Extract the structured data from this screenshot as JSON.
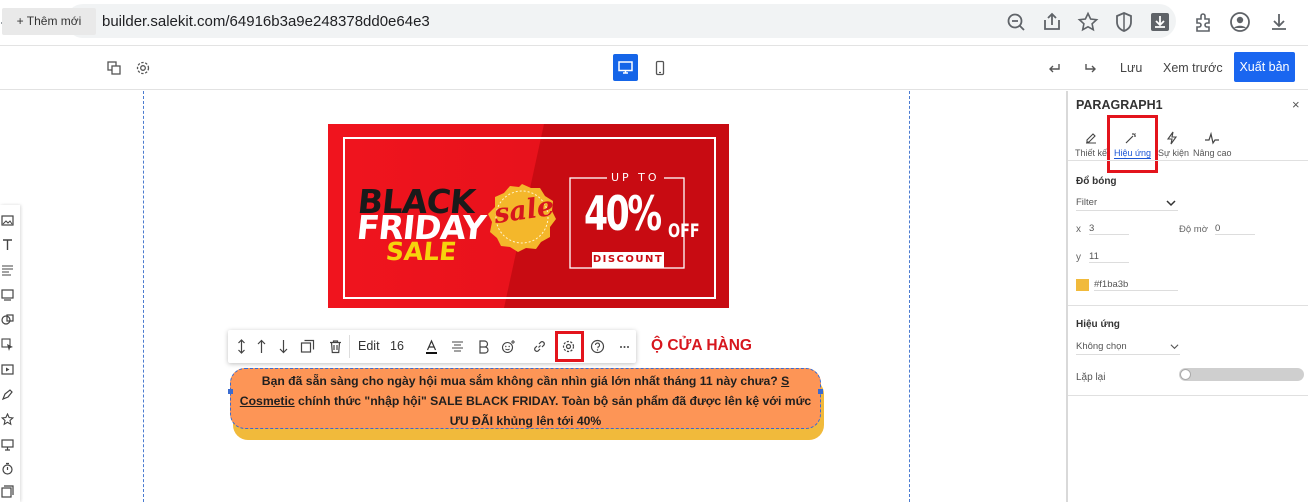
{
  "browser": {
    "url": "builder.salekit.com/64916b3a9e248378dd0e64e3"
  },
  "builder_toolbar": {
    "add_new": "+ Thêm mới",
    "save": "Lưu",
    "preview": "Xem trước",
    "publish": "Xuất bản"
  },
  "element_toolbar": {
    "edit": "Edit",
    "font_size": "16"
  },
  "banner": {
    "black": "BLACK",
    "friday": "FRIDAY",
    "sale": "SALE",
    "sale_badge": "sale",
    "up_to": "UP TO",
    "percent": "40%",
    "off": "OFF",
    "discount": "DISCOUNT"
  },
  "heading_fragment": "Ộ CỬA HÀNG",
  "paragraph": {
    "text_before": "Bạn đã sẵn sàng cho ngày hội mua sắm không cần nhìn giá lớn nhất tháng 11 này chưa? ",
    "link": "S Cosmetic",
    "text_after": " chính thức \"nhập hội\" SALE BLACK FRIDAY. Toàn bộ sản phẩm đã được lên kệ với mức ƯU ĐÃI khủng lên tới 40%"
  },
  "panel": {
    "title": "PARAGRAPH1",
    "close": "×",
    "tabs": [
      "Thiết kế",
      "Hiệu ứng",
      "Sự kiện",
      "Nâng cao"
    ],
    "shadow_section": "Đổ bóng",
    "filter_select": "Filter",
    "x_label": "x",
    "x_value": "3",
    "blur_label": "Độ mờ",
    "blur_value": "0",
    "y_label": "y",
    "y_value": "11",
    "color_value": "#f1ba3b",
    "effect_section": "Hiệu ứng",
    "effect_select": "Không chọn",
    "repeat_label": "Lặp lại"
  },
  "colors": {
    "accent": "#1a66f0",
    "banner_red": "#e3111d",
    "paragraph_bg": "#fd9556",
    "shadow": "#f1ba3b",
    "highlight": "#e3141c"
  }
}
